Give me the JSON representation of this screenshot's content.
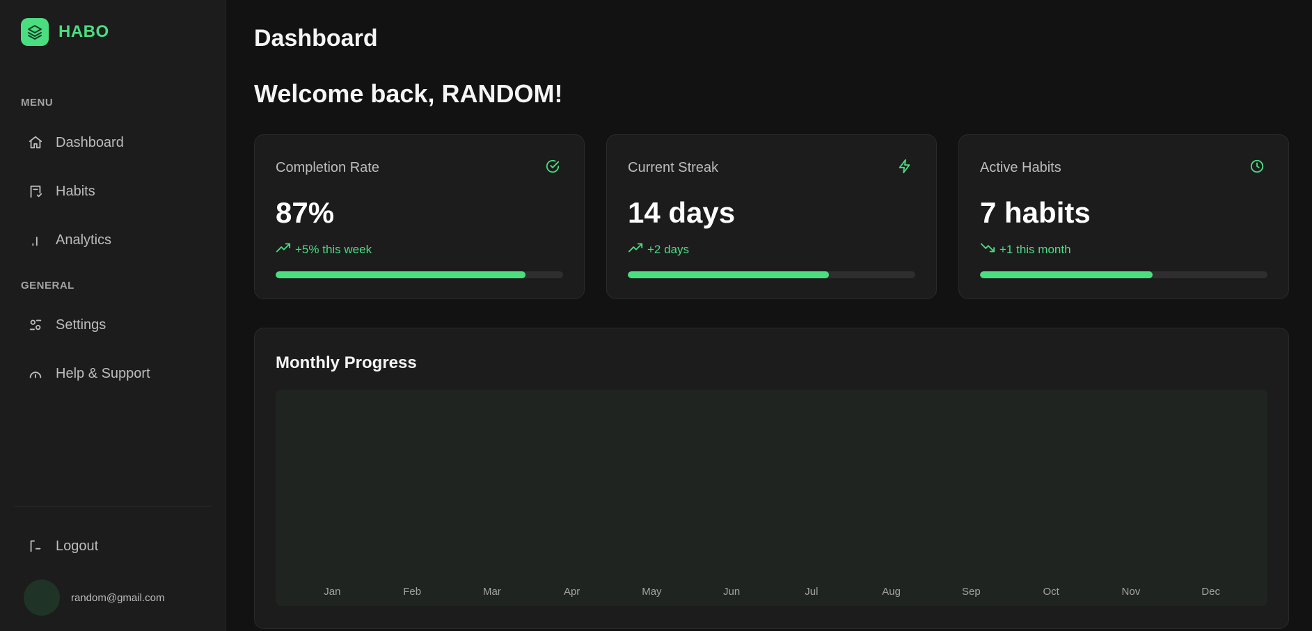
{
  "brand": {
    "name": "HABO",
    "accent": "#4ade80"
  },
  "sidebar": {
    "menu_label": "MENU",
    "general_label": "GENERAL",
    "menu_items": [
      {
        "label": "Dashboard",
        "icon": "home-icon"
      },
      {
        "label": "Habits",
        "icon": "habits-icon"
      },
      {
        "label": "Analytics",
        "icon": "analytics-icon"
      }
    ],
    "general_items": [
      {
        "label": "Settings",
        "icon": "settings-icon"
      },
      {
        "label": "Help & Support",
        "icon": "help-icon"
      }
    ],
    "logout_label": "Logout",
    "user_email": "random@gmail.com"
  },
  "main": {
    "page_title": "Dashboard",
    "welcome": "Welcome back, RANDOM!",
    "stats": [
      {
        "label": "Completion Rate",
        "value": "87%",
        "trend": "+5% this week",
        "trend_icon": "trending-up-icon",
        "icon": "check-circle-icon",
        "progress": 0.87
      },
      {
        "label": "Current Streak",
        "value": "14 days",
        "trend": "+2 days",
        "trend_icon": "trending-up-icon",
        "icon": "lightning-icon",
        "progress": 0.7
      },
      {
        "label": "Active Habits",
        "value": "7 habits",
        "trend": "+1 this month",
        "trend_icon": "trending-down-icon",
        "icon": "clock-icon",
        "progress": 0.6
      }
    ],
    "monthly": {
      "title": "Monthly Progress",
      "months": [
        "Jan",
        "Feb",
        "Mar",
        "Apr",
        "May",
        "Jun",
        "Jul",
        "Aug",
        "Sep",
        "Oct",
        "Nov",
        "Dec"
      ]
    }
  }
}
